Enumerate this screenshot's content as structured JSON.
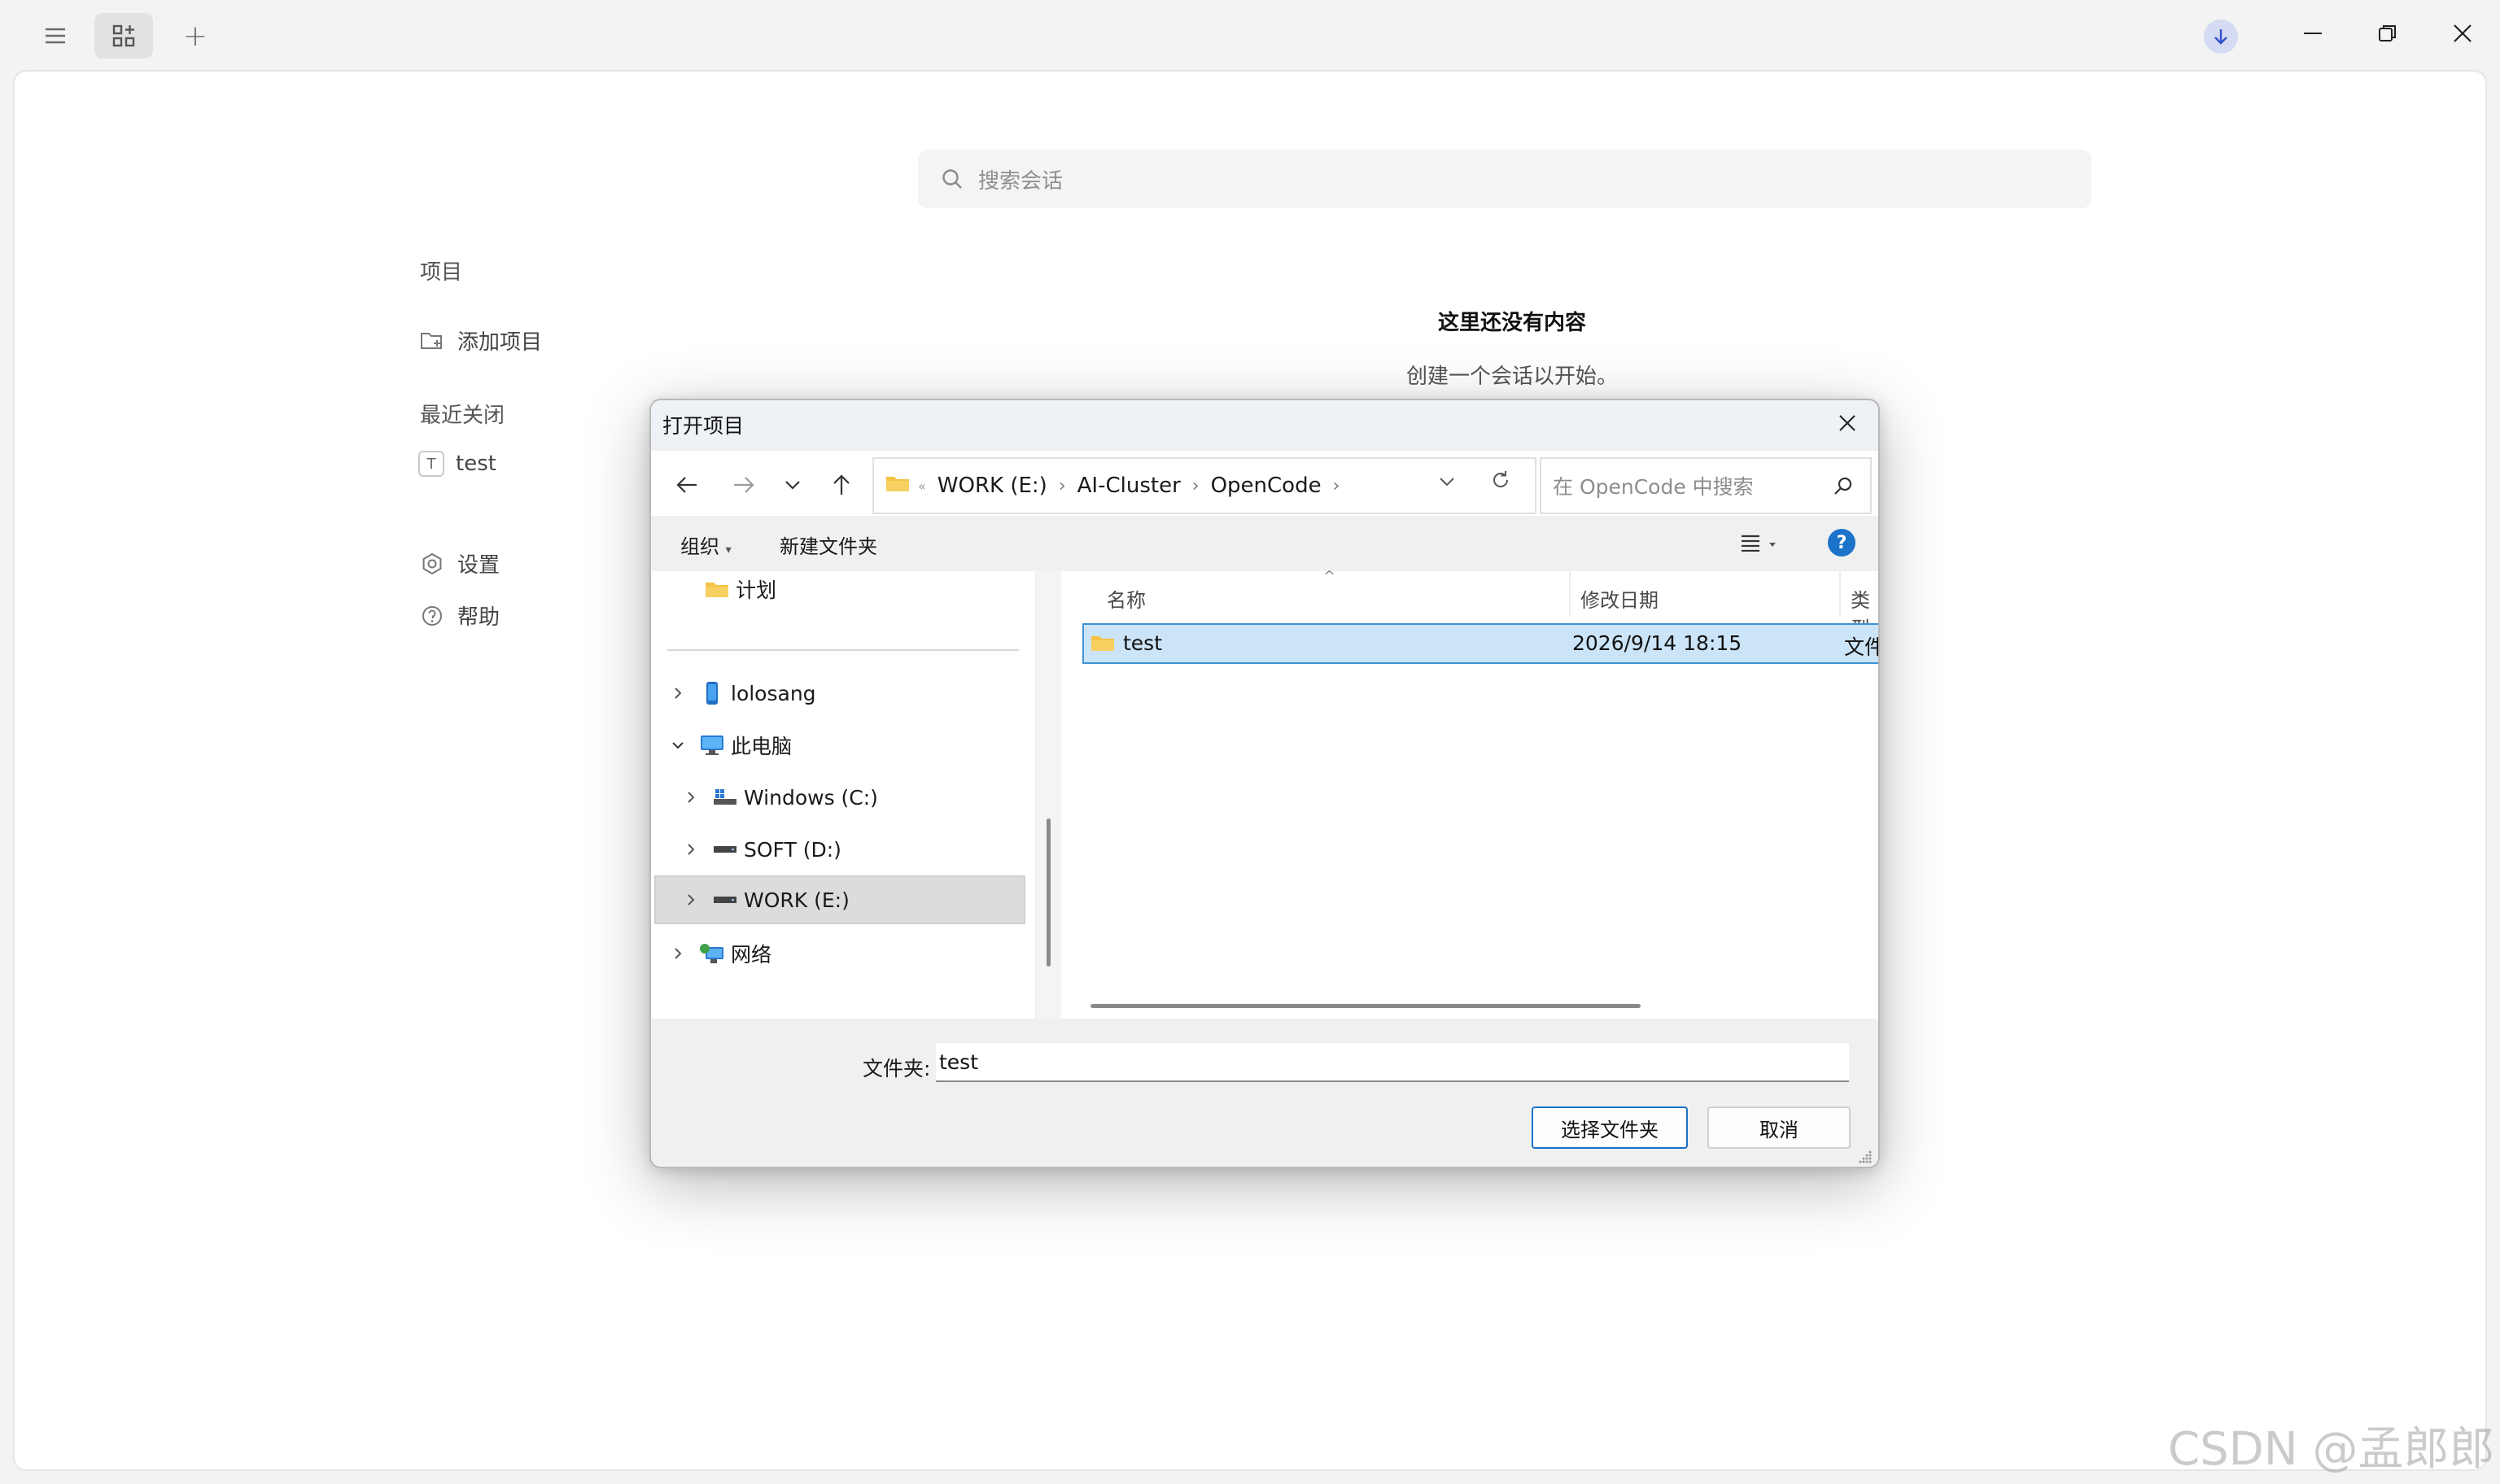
{
  "titlebar": {
    "menu_icon": "hamburger-icon",
    "grid_icon": "grid-add-icon",
    "plus": "+",
    "download_icon": "download-icon"
  },
  "search": {
    "placeholder": "搜索会话"
  },
  "sidebar": {
    "projects_title": "项目",
    "add_project": "添加项目",
    "recent_title": "最近关闭",
    "recent_items": [
      {
        "badge": "T",
        "label": "test"
      }
    ],
    "settings": "设置",
    "help": "帮助"
  },
  "empty": {
    "title": "这里还没有内容",
    "subtitle": "创建一个会话以开始。"
  },
  "dialog": {
    "title": "打开项目",
    "breadcrumb": [
      "WORK (E:)",
      "AI-Cluster",
      "OpenCode"
    ],
    "search_placeholder": "在 OpenCode 中搜索",
    "toolbar": {
      "organize": "组织",
      "new_folder": "新建文件夹"
    },
    "tree": {
      "pinned": "计划",
      "user": "lolosang",
      "this_pc": "此电脑",
      "drives": [
        "Windows (C:)",
        "SOFT (D:)",
        "WORK (E:)"
      ],
      "network": "网络"
    },
    "columns": {
      "name": "名称",
      "date": "修改日期",
      "type": "类型"
    },
    "files": [
      {
        "name": "test",
        "date": "2026/9/14 18:15",
        "type": "文件夹"
      }
    ],
    "folder_label": "文件夹:",
    "folder_value": "test",
    "select_button": "选择文件夹",
    "cancel_button": "取消"
  },
  "watermark": "CSDN @孟郎郎",
  "colors": {
    "accent": "#1a73c9",
    "selection": "#cce4f7",
    "folder": "#f5c243"
  }
}
